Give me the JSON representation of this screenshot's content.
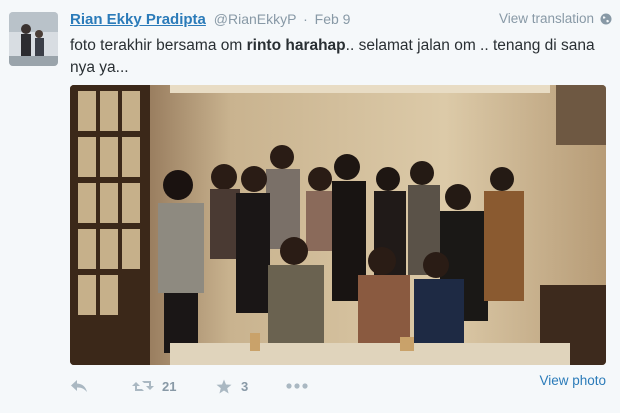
{
  "tweet": {
    "fullname": "Rian Ekky Pradipta",
    "handle": "@RianEkkyP",
    "separator": "·",
    "time": "Feb 9",
    "view_translation": "View translation",
    "text_part1": "foto terakhir bersama om ",
    "text_bold": "rinto harahap",
    "text_part2": ".. selamat jalan om .. tenang di sana nya ya...",
    "retweet_count": "21",
    "favorite_count": "3",
    "view_photo": "View photo"
  },
  "colors": {
    "link": "#2b7bb9",
    "muted": "#8899a6",
    "background": "#f5f8fa"
  },
  "icons": [
    "reply-icon",
    "retweet-icon",
    "favorite-icon",
    "more-icon",
    "globe-icon"
  ]
}
